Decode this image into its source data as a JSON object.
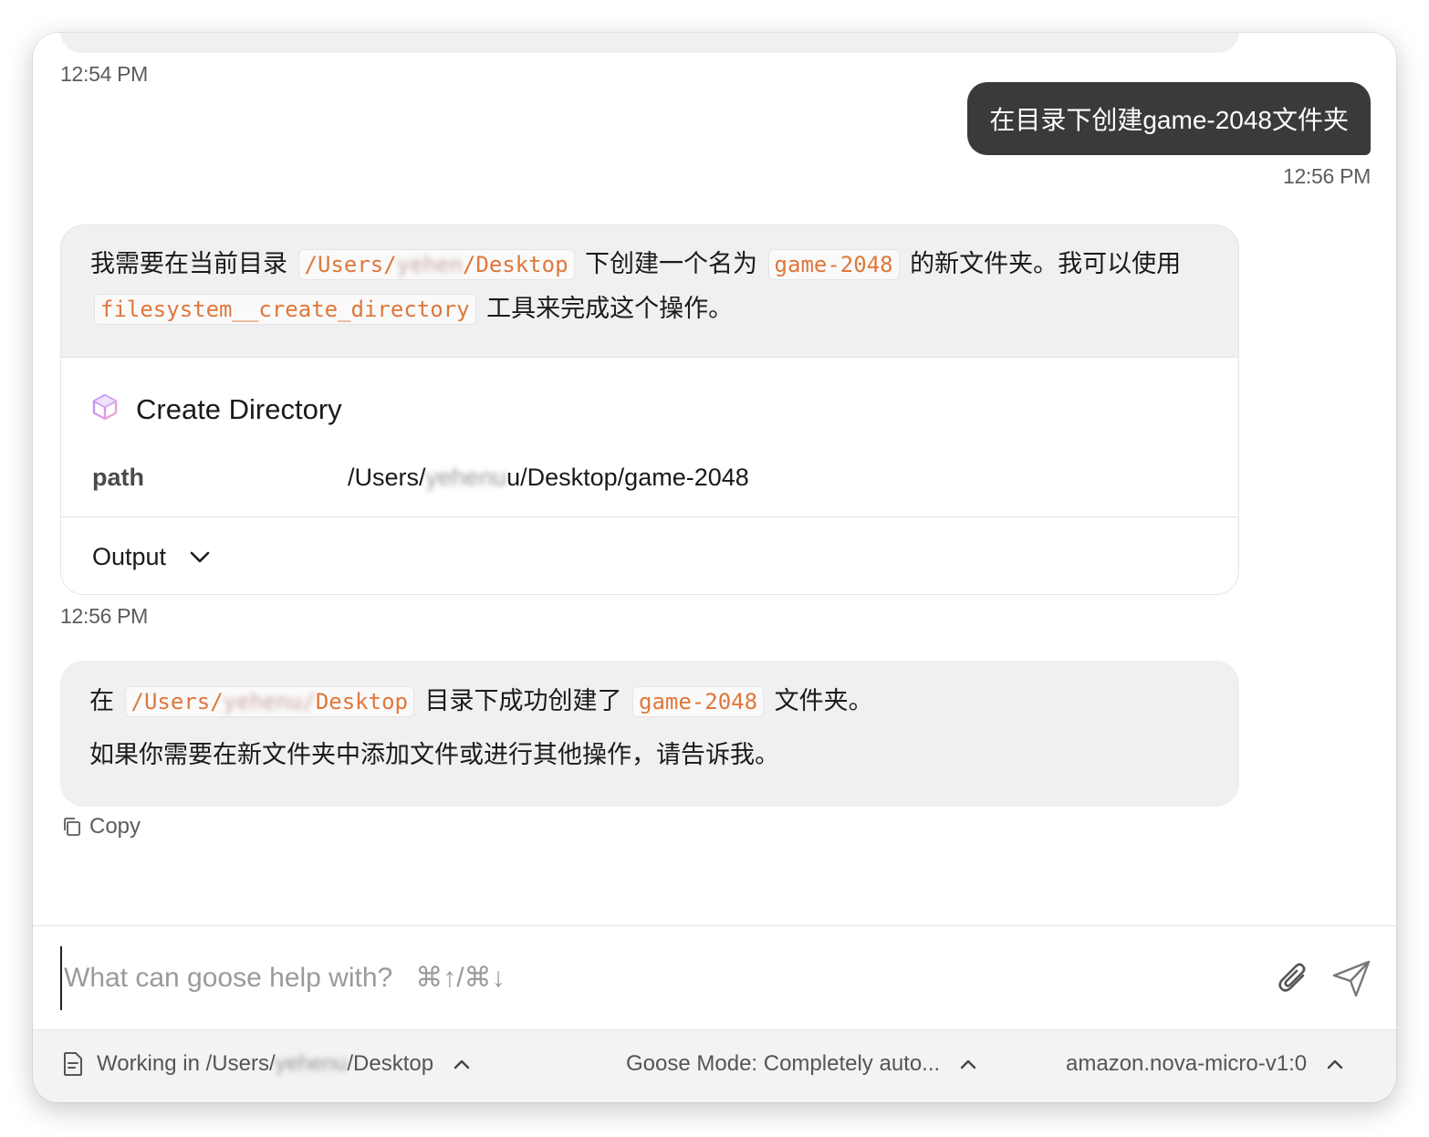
{
  "messages": {
    "prev_time": "12:54 PM",
    "user": {
      "text": "在目录下创建game-2048文件夹",
      "time": "12:56 PM"
    },
    "agent": {
      "text_1": "我需要在当前目录",
      "path_code_start": "/Users/",
      "path_code_blur": "yehen",
      "path_code_end": "/Desktop",
      "text_2": "下创建一个名为",
      "folder_code": "game-2048",
      "text_3": "的新文件夹。我可以使用",
      "tool_code": "filesystem__create_directory",
      "text_4": "工具来完成这个操作。",
      "tool": {
        "title": "Create Directory",
        "param_key": "path",
        "param_val_start": "/Users/",
        "param_val_blur": "yehenu",
        "param_val_end": "u/Desktop/game-2048",
        "output_label": "Output"
      },
      "time": "12:56 PM"
    },
    "reply": {
      "text_1": "在",
      "path_code_start": "/Users/",
      "path_code_blur": "yehenu/",
      "path_code_end": "Desktop",
      "text_2": "目录下成功创建了",
      "folder_code": "game-2048",
      "text_3": "文件夹。",
      "line2": "如果你需要在新文件夹中添加文件或进行其他操作，请告诉我。",
      "copy_label": "Copy"
    }
  },
  "input": {
    "placeholder": "What can goose help with?   ⌘↑/⌘↓"
  },
  "status_bar": {
    "working_prefix": "Working in /Users/",
    "working_blur": "yehenu",
    "working_suffix": "/Desktop",
    "mode": "Goose Mode: Completely auto...",
    "model": "amazon.nova-micro-v1:0"
  },
  "colors": {
    "code_text": "#e0773a",
    "user_bubble": "#3a3a3a",
    "card_bg": "#f0f0f0"
  },
  "icons": [
    "cube-icon",
    "chevron-down-icon",
    "copy-icon",
    "paperclip-icon",
    "send-icon",
    "document-icon",
    "chevron-up-icon"
  ]
}
